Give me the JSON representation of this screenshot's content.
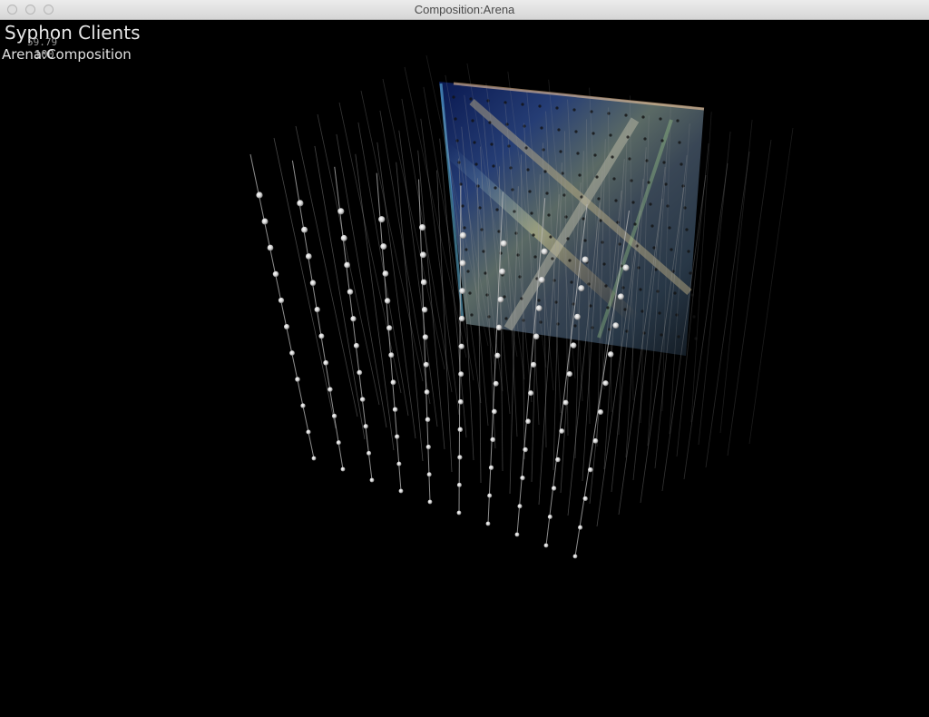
{
  "window": {
    "title": "Composition:Arena"
  },
  "overlay": {
    "heading": "Syphon Clients",
    "fps": "59.79",
    "client_name": "Arena:Composition",
    "client_value": "100"
  },
  "scene": {
    "description_icon": "led-cube-grid",
    "background_color": "#000000",
    "node_color": "#f2f2f2",
    "panel_colors": [
      "#1a3a8a",
      "#6fd3ff",
      "#f0e08a",
      "#ff9a3c",
      "#3a8a3a"
    ]
  }
}
